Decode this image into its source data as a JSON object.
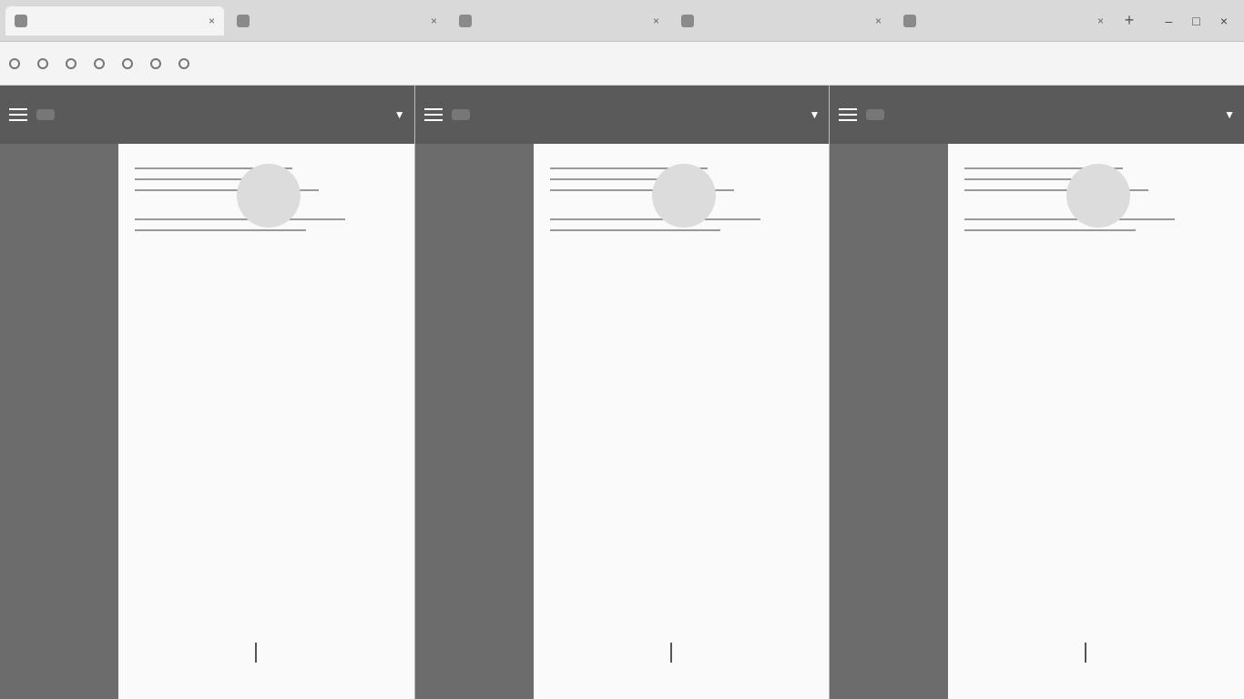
{
  "tabs": [
    {
      "label": ""
    },
    {
      "label": ""
    },
    {
      "label": ""
    },
    {
      "label": ""
    },
    {
      "label": ""
    }
  ],
  "bookmarks": [
    {
      "label": ""
    },
    {
      "label": ""
    },
    {
      "label": ""
    },
    {
      "label": ""
    },
    {
      "label": ""
    },
    {
      "label": ""
    },
    {
      "label": ""
    }
  ],
  "panes": [
    {
      "toolbar_button": "",
      "heading": "",
      "signature": ""
    },
    {
      "toolbar_button": "",
      "heading": "",
      "signature": ""
    },
    {
      "toolbar_button": "",
      "heading": "",
      "signature": ""
    }
  ]
}
